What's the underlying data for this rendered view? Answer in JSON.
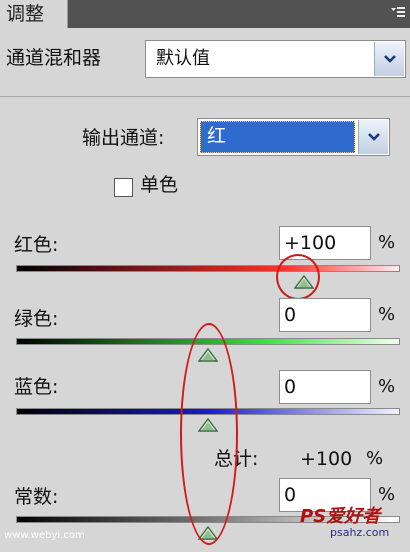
{
  "panel": {
    "tab_label": "调整",
    "menu_icon": "panel-menu-icon"
  },
  "mixer": {
    "title": "通道混和器",
    "preset_value": "默认值"
  },
  "output": {
    "label": "输出通道:",
    "value": "红"
  },
  "monochrome": {
    "label": "单色",
    "checked": false
  },
  "channels": {
    "red": {
      "label": "红色:",
      "value": "+100",
      "unit": "%",
      "level_percent": 100
    },
    "green": {
      "label": "绿色:",
      "value": "0",
      "unit": "%",
      "level_percent": 0
    },
    "blue": {
      "label": "蓝色:",
      "value": "0",
      "unit": "%",
      "level_percent": 0
    }
  },
  "total": {
    "label": "总计:",
    "value": "+100",
    "unit": "%"
  },
  "constant": {
    "label": "常数:",
    "value": "0",
    "unit": "%",
    "level_percent": 0
  },
  "watermark": {
    "left": "www.webyi.com",
    "right": "PS爱好者",
    "right_sub": "psahz.com"
  },
  "colors": {
    "red_track_end": "#ff3030",
    "green_track_end": "#3be33b",
    "blue_track_end": "#1a1ad0",
    "annotation": "#d21a1a",
    "selection": "#2f6acf"
  }
}
